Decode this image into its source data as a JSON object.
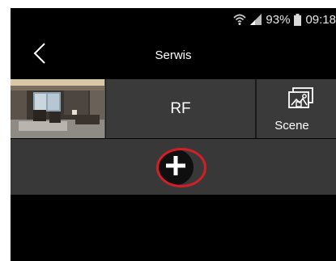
{
  "status_bar": {
    "battery_percent": "93%",
    "time": "09:18"
  },
  "header": {
    "title": "Serwis"
  },
  "tiles": {
    "rf_label": "RF",
    "scene_label": "Scene"
  },
  "icons": {
    "wifi": "wifi-icon",
    "signal": "signal-icon",
    "battery": "battery-icon",
    "back": "chevron-left-icon",
    "scene": "scene-icon",
    "add": "plus-icon"
  },
  "colors": {
    "background": "#000000",
    "tile": "#3a3a3a",
    "add_row": "#383838",
    "highlight": "#d21f26"
  }
}
